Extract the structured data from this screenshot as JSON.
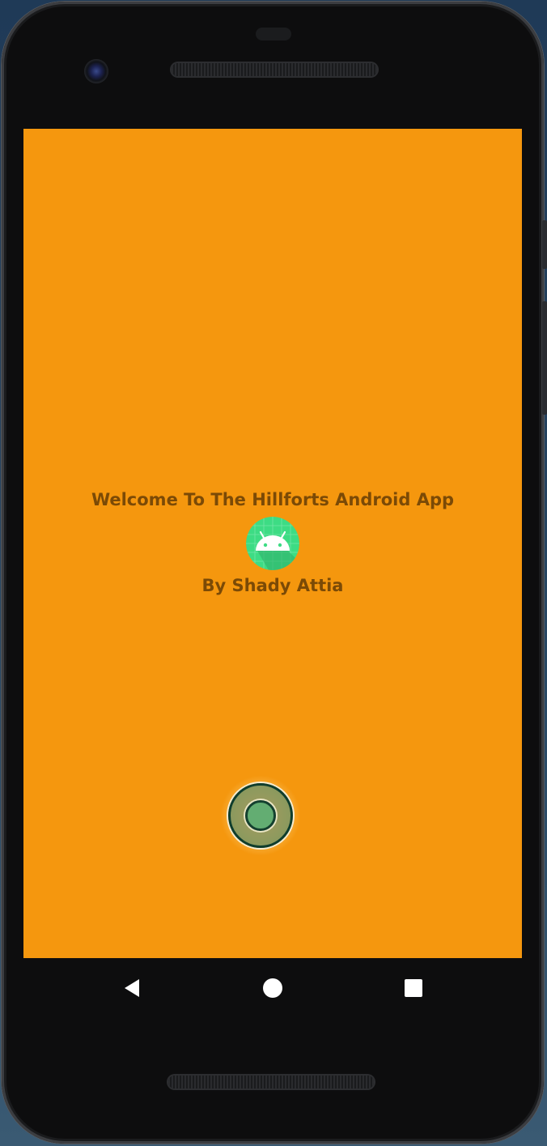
{
  "app": {
    "title": "Welcome To The Hillforts Android App",
    "author": "By Shady Attia",
    "app_icon": "android-robot-icon",
    "background_color": "#f5970e",
    "text_color": "#7b4a06"
  },
  "record_button": {
    "icon": "record-icon",
    "fill_color": "#63ad72"
  },
  "navigation_bar": {
    "back_icon": "back-triangle-icon",
    "home_icon": "home-circle-icon",
    "recents_icon": "recents-square-icon"
  }
}
